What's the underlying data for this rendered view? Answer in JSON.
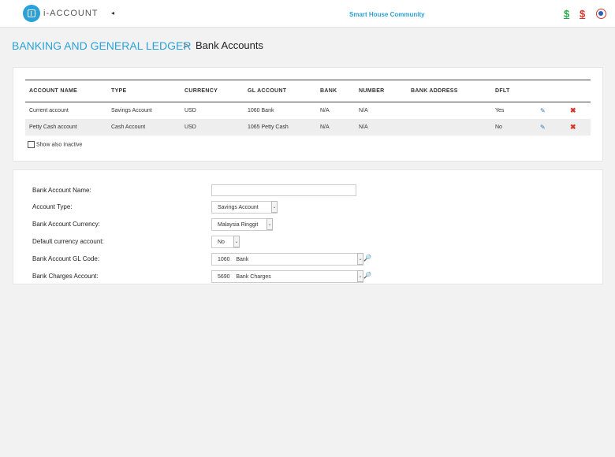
{
  "header": {
    "app_name": "i-ACCOUNT",
    "collapse_glyph": "◂",
    "company": "Smart House Community",
    "icons": [
      "green-dollar-icon",
      "red-dollar-icon",
      "flag-icon"
    ],
    "dollar": "$"
  },
  "breadcrumb": {
    "section": "BANKING AND GENERAL LEDGER",
    "separator": ">",
    "page": "Bank Accounts"
  },
  "table": {
    "columns": [
      "ACCOUNT NAME",
      "TYPE",
      "CURRENCY",
      "GL ACCOUNT",
      "BANK",
      "NUMBER",
      "BANK ADDRESS",
      "DFLT"
    ],
    "rows": [
      {
        "name": "Current account",
        "type": "Savings Account",
        "currency": "USD",
        "gl": "1060 Bank",
        "bank": "N/A",
        "number": "N/A",
        "address": "",
        "dflt": "Yes"
      },
      {
        "name": "Petty Cash account",
        "type": "Cash Account",
        "currency": "USD",
        "gl": "1065 Petty Cash",
        "bank": "N/A",
        "number": "N/A",
        "address": "",
        "dflt": "No"
      }
    ],
    "edit_glyph": "✎",
    "delete_glyph": "✖",
    "show_inactive_label": "Show also Inactive"
  },
  "form": {
    "name_label": "Bank Account Name:",
    "name_value": "",
    "type_label": "Account Type:",
    "type_value": "Savings Account",
    "currency_label": "Bank Account Currency:",
    "currency_value": "Malaysia Ringgit",
    "default_label": "Default currency account:",
    "default_value": "No",
    "gl_label": "Bank Account GL Code:",
    "gl_code": "1060",
    "gl_name": "Bank",
    "charges_label": "Bank Charges Account:",
    "charges_code": "5690",
    "charges_name": "Bank Charges",
    "arrow_glyph": "⌄",
    "search_glyph": "🔎"
  }
}
